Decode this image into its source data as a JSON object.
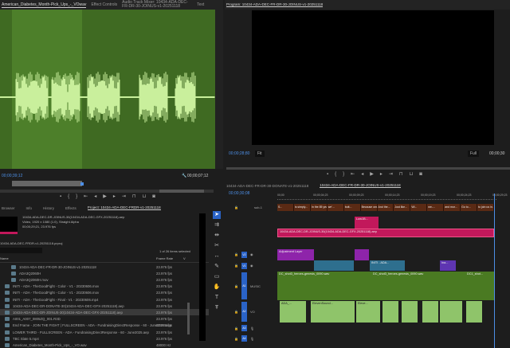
{
  "top_tabs": {
    "source": "American_Diabetes_Month-Pick_Ups_-_VOwav",
    "effect_controls": "Effect Controls",
    "audio_mixer": "Audio Track Mixer: 10434-ADA-DEC-FR-DR-30-JOINUS-v1-20251118",
    "text": "Text",
    "program": "Program: 10434-ADA-DEC-FR-DR-30-JOINUS-v1-20251118"
  },
  "source": {
    "timecode_in": "00;00;39;12",
    "timecode_dur": "00;00;07;12"
  },
  "program": {
    "timecode": "00;00;28;80",
    "zoom": "Fit",
    "quality": "Full",
    "timecode_end": "00;00;30"
  },
  "project": {
    "tabs": [
      "Browser",
      "Info",
      "History",
      "Effects",
      "Project: 10434-ADA-DEC-FRDR-v1-20251118"
    ],
    "preview_name": "10434-ADA-DEC-DR-JOINUS-30(10434-ADA-DEC-GFX-20251118).aep",
    "preview_info1": "Video, 1920 x 1080 (1.0), Straight Alpha",
    "preview_info2": "00;00;29;21, 23.976 fps",
    "project_file": "10434-ADA-DEC-FRDR-v1-20251118.prproj",
    "selection": "1 of 26 items selected",
    "col_name": "Name",
    "col_fps": "Frame Rate",
    "col_v": "V",
    "items": [
      {
        "name": "10434-ADA-DEC-FR-DR-30-JOINUS-v1-20251118",
        "fps": "23.976 fps",
        "indent": 1
      },
      {
        "name": "ADA3Q2060H",
        "fps": "23.976 fps",
        "indent": 1
      },
      {
        "name": "ADA3Q2060H.mov",
        "fps": "23.976 fps",
        "indent": 1
      },
      {
        "name": "INITI - ADA - TheGoodFight - Color - V1 - 20230606.mov",
        "fps": "23.976 fps",
        "indent": 0
      },
      {
        "name": "INITI - ADA - TheGoodFight - Color - V1 - 20230606.mov",
        "fps": "23.976 fps",
        "indent": 0
      },
      {
        "name": "INITI - ADA - TheGoodFight - Final - V1 - 20230606.mp4",
        "fps": "23.976 fps",
        "indent": 0
      },
      {
        "name": "10434-ADA-DEC-DR-DONATE-30(10434-ADA-DEC-GFX-20251118).aep",
        "fps": "23.976 fps",
        "indent": 0
      },
      {
        "name": "10434-ADA-DEC-DR-JOINUS-30(10434-ADA-DEC-GFX-20251118).aep",
        "fps": "23.976 fps",
        "indent": 0,
        "selected": true
      },
      {
        "name": "A001_A007_0805ZQ_001.R3D",
        "fps": "23.976 fps",
        "indent": 0
      },
      {
        "name": "End Frame - JOIN THE FIGHT | FULLSCREEN - ADA - FundraisingDirectResponse - 60 - June2025.aep",
        "fps": "23.976 fps",
        "indent": 0
      },
      {
        "name": "LOWER THIRD - FULLSCREEN - ADA - FundraisingDirectResponse - 60 - June2025.aep",
        "fps": "23.976 fps",
        "indent": 0
      },
      {
        "name": "TBC Slate 5.mp4",
        "fps": "23.976 fps",
        "indent": 0
      },
      {
        "name": "American_Diabetes_Month-Pick_Ups_-_VO.wav",
        "fps": "48000 Hz",
        "indent": 0
      }
    ]
  },
  "timeline": {
    "tabs": [
      "10434-ADA-DEC-FR-DR-30-DONATE-v1-20251118",
      "10434-ADA-DEC-FR-DR-30-JOINUS-v1-20251118"
    ],
    "timecode": "00;00;30;08",
    "ruler": [
      "00;00",
      "00;00;04;23",
      "00;00;09;23",
      "00;00;14;23",
      "00;00;19;23",
      "00;00;24;23",
      "00;00;29;23"
    ],
    "caption_track": "sub-1",
    "captions": [
      "S...",
      "is simply...",
      "In the 85 yea...",
      "we'...",
      "butt...",
      "Because one...",
      "And the...",
      "Just like...",
      "Wi...",
      "we-...",
      "and mor...",
      "Go to...",
      "to join us in..."
    ],
    "tracks": {
      "v2": "V2",
      "v1": "V1",
      "a1": "A1",
      "a1_name": "MUSIC",
      "a2": "A2",
      "a2_name": "VO",
      "a3": "A3",
      "a4": "A4"
    },
    "clips": {
      "lower_third": "Low1B...",
      "graphic": "10434-ADA-DEC-DR-JOINUS-30(10434-ADA-DEC-GFX-20251118).aep",
      "adjustment": "Adjustment Layer",
      "v1_b": "INITI - ADA...",
      "v1_c": "Ina...",
      "music1": "DC_shot3_heroes-genesis_0090.wav",
      "music2": "DC_shot3_heroes-genesis_0090.wav",
      "music3": "DC1_shot...",
      "vo1": "ADA_...",
      "vo2": "ElevenSound...",
      "vo3": "Eleve..."
    }
  }
}
